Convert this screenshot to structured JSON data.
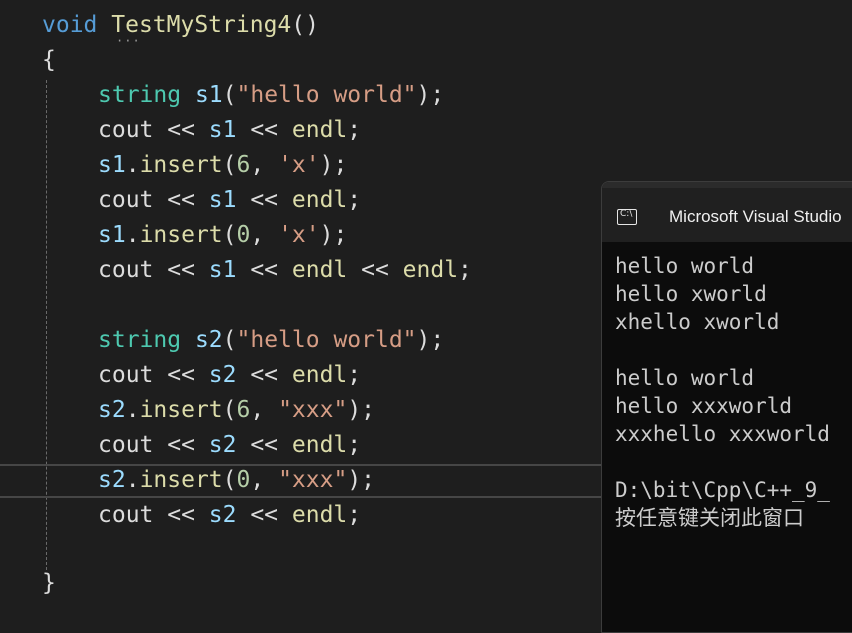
{
  "editor": {
    "lines": [
      {
        "tokens": [
          "void",
          " ",
          "TestMyString4",
          "()"
        ]
      },
      {
        "tokens": [
          "{"
        ]
      },
      {
        "tokens": [
          "string",
          " ",
          "s1",
          "(",
          "\"hello world\"",
          ");"
        ]
      },
      {
        "tokens": [
          "cout",
          " << ",
          "s1",
          " << ",
          "endl",
          ";"
        ]
      },
      {
        "tokens": [
          "s1",
          ".",
          "insert",
          "(",
          "6",
          ", ",
          "'x'",
          ");"
        ]
      },
      {
        "tokens": [
          "cout",
          " << ",
          "s1",
          " << ",
          "endl",
          ";"
        ]
      },
      {
        "tokens": [
          "s1",
          ".",
          "insert",
          "(",
          "0",
          ", ",
          "'x'",
          ");"
        ]
      },
      {
        "tokens": [
          "cout",
          " << ",
          "s1",
          " << ",
          "endl",
          " << ",
          "endl",
          ";"
        ]
      },
      {
        "tokens": [
          "string",
          " ",
          "s2",
          "(",
          "\"hello world\"",
          ");"
        ]
      },
      {
        "tokens": [
          "cout",
          " << ",
          "s2",
          " << ",
          "endl",
          ";"
        ]
      },
      {
        "tokens": [
          "s2",
          ".",
          "insert",
          "(",
          "6",
          ", ",
          "\"xxx\"",
          ");"
        ]
      },
      {
        "tokens": [
          "cout",
          " << ",
          "s2",
          " << ",
          "endl",
          ";"
        ]
      },
      {
        "tokens": [
          "s2",
          ".",
          "insert",
          "(",
          "0",
          ", ",
          "\"xxx\"",
          ");"
        ]
      },
      {
        "tokens": [
          "cout",
          " << ",
          "s2",
          " << ",
          "endl",
          ";"
        ]
      },
      {
        "tokens": [
          "}"
        ]
      }
    ],
    "hint_dots": "···"
  },
  "console": {
    "icon_label": "C:\\",
    "title": "Microsoft Visual Studio",
    "output": [
      "hello world",
      "hello xworld",
      "xhello xworld",
      "",
      "hello world",
      "hello xxxworld",
      "xxxhello xxxworld",
      "",
      "D:\\bit\\Cpp\\C++_9_",
      "按任意键关闭此窗口"
    ]
  },
  "colors": {
    "keyword": "#569cd6",
    "function": "#dcdcaa",
    "variable": "#9cdcfe",
    "string": "#d69d85",
    "type": "#4ec9b0",
    "number": "#b5cea8",
    "background": "#1e1e1e",
    "console_background": "#0c0c0c"
  }
}
